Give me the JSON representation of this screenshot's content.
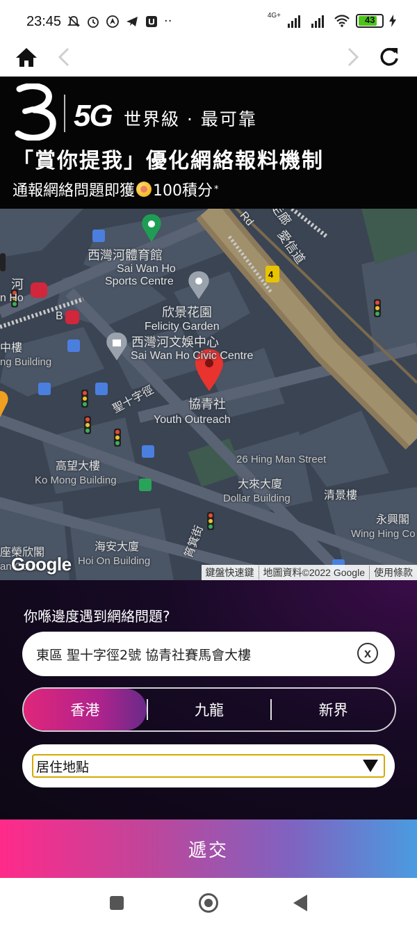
{
  "status_bar": {
    "time": "23:45",
    "network": "4G+",
    "battery": "43",
    "left_icons": [
      "mute-icon",
      "alarm-icon",
      "location-icon",
      "telegram-icon",
      "app-icon",
      "more-icon"
    ]
  },
  "banner": {
    "brand_5g": "5G",
    "tagline": "世界級 · 最可靠",
    "headline": "「賞你提我」優化網絡報料機制",
    "sub_text": "通報網絡問題即獲",
    "points": "100積分",
    "asterisk": "*"
  },
  "map": {
    "labels": {
      "sports_centre_zh": "西灣河體育館",
      "sports_centre_en1": "Sai Wan Ho",
      "sports_centre_en2": "Sports Centre",
      "felicity_zh": "欣景花園",
      "felicity_en": "Felicity Garden",
      "civic_zh": "西灣河文娛中心",
      "civic_en": "Sai Wan Ho Civic Centre",
      "youth_zh": "協青社",
      "youth_en": "Youth Outreach",
      "road_holy_cross": "聖十字徑",
      "hing_man": "26 Hing Man Street",
      "ko_mong_zh": "高望大樓",
      "ko_mong_en": "Ko Mong Building",
      "dollar_zh": "大來大廈",
      "dollar_en": "Dollar Building",
      "tsing_king": "清景樓",
      "wing_hing_zh": "永興閣",
      "wing_hing_en": "Wing Hing Co",
      "hoi_on_zh": "海安大廈",
      "hoi_on_en": "Hoi On Building",
      "left_building_zh": "中樓",
      "left_building_en": "ng Building",
      "left_river": "河",
      "left_ho": "n Ho",
      "left_bottom_zh": "座榮欣閣",
      "left_bottom_en": "an Court",
      "rd": "Rd",
      "road_right": "愛信道",
      "road_right2": "走廊",
      "route_num": "4",
      "street_bottom": "筲箕街",
      "b_label": "B"
    },
    "google": "Google",
    "attrib_keyboard": "鍵盤快速鍵",
    "attrib_data": "地圖資料©2022 Google",
    "attrib_terms": "使用條款"
  },
  "form": {
    "question": "你喺邊度遇到網絡問題?",
    "address_value": "東區 聖十字徑2號 協青社賽馬會大樓",
    "clear_label": "x",
    "regions": [
      "香港",
      "九龍",
      "新界"
    ],
    "selected_region": "香港",
    "location_type": "居住地點",
    "submit_label": "遞交"
  },
  "colors": {
    "banner_bg": "#050505",
    "form_bg": "#160a24",
    "active_tab": "#e0267a",
    "select_border": "#d6a800",
    "map_bg": "#3a4452"
  }
}
